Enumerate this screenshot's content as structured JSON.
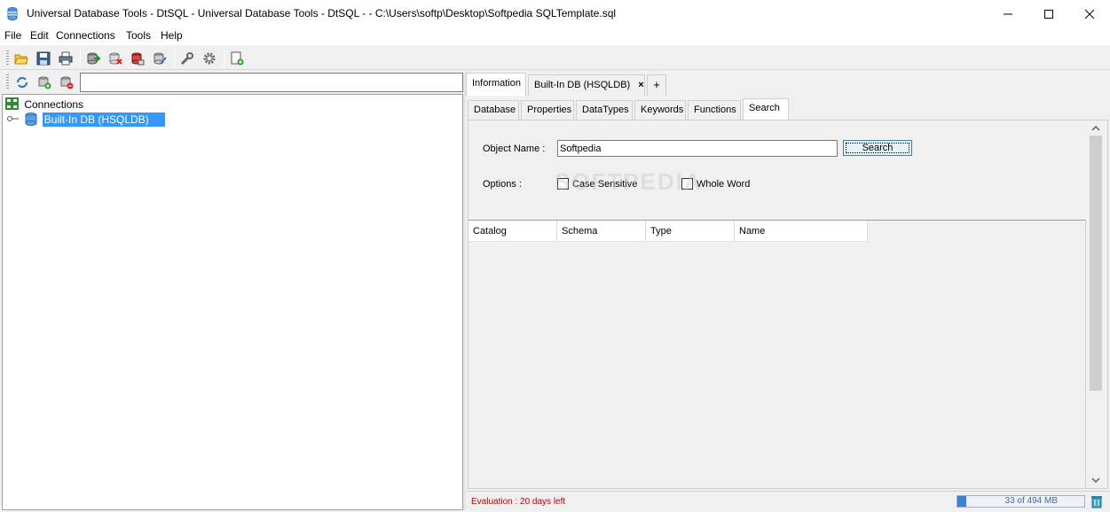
{
  "window": {
    "title": "Universal Database Tools - DtSQL - Universal Database Tools - DtSQL - - C:\\Users\\softp\\Desktop\\Softpedia SQLTemplate.sql"
  },
  "menu": [
    "File",
    "Edit",
    "Connections",
    "Tools",
    "Help"
  ],
  "toolbar": {
    "icons": [
      "open-folder-icon",
      "save-icon",
      "print-icon",
      "connect-db-icon",
      "disconnect-db-icon",
      "remove-db-icon",
      "edit-db-icon",
      "wrench-icon",
      "gear-icon",
      "new-document-icon"
    ]
  },
  "left_toolbar": {
    "icons": [
      "refresh-icon",
      "add-connection-icon",
      "remove-connection-icon"
    ],
    "filter_value": ""
  },
  "tree": {
    "root_label": "Connections",
    "child_label": "Built-In DB (HSQLDB)"
  },
  "main_tabs": [
    {
      "label": "Information",
      "active": true
    },
    {
      "label": "Built-In DB (HSQLDB)",
      "active": false,
      "close": "×"
    },
    {
      "label": "+",
      "active": false
    }
  ],
  "sub_tabs": [
    {
      "label": "Database"
    },
    {
      "label": "Properties"
    },
    {
      "label": "DataTypes"
    },
    {
      "label": "Keywords"
    },
    {
      "label": "Functions"
    },
    {
      "label": "Search",
      "active": true
    }
  ],
  "search_form": {
    "object_name_label": "Object Name :",
    "object_name_value": "Softpedia",
    "search_button": "Search",
    "options_label": "Options :",
    "case_sensitive_label": "Case Sensitive",
    "whole_word_label": "Whole Word"
  },
  "results": {
    "columns": [
      "Catalog",
      "Schema",
      "Type",
      "Name"
    ]
  },
  "status": {
    "evaluation": "Evaluation : 20 days left",
    "memory": "33 of 494 MB",
    "memory_fraction": 0.067
  },
  "watermark": "SOFTPEDIA",
  "colors": {
    "selection": "#3399ff",
    "eval_text": "#c00000",
    "memory_bar": "#3b7fd6"
  }
}
